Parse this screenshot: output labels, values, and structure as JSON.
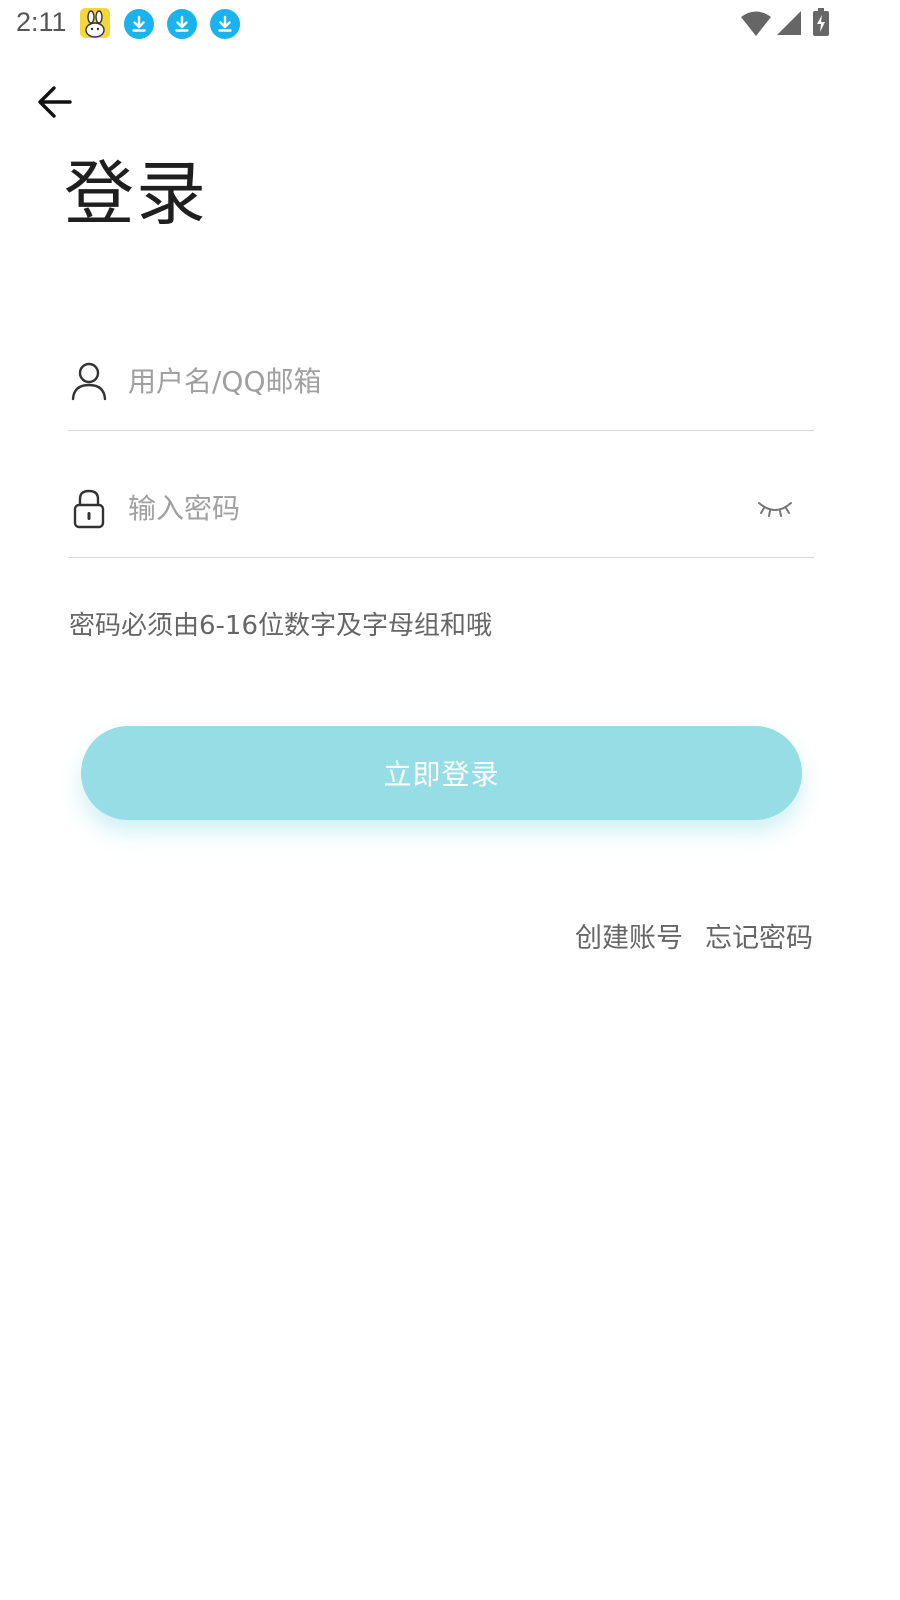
{
  "status_bar": {
    "time": "2:11",
    "icons": [
      "notification-app-icon",
      "download-icon",
      "download-icon",
      "download-icon",
      "wifi-icon",
      "signal-icon",
      "battery-charging-icon"
    ]
  },
  "header": {
    "back_icon": "arrow-left-icon",
    "title": "登录"
  },
  "form": {
    "username": {
      "icon": "person-icon",
      "placeholder": "用户名/QQ邮箱",
      "value": ""
    },
    "password": {
      "icon": "lock-icon",
      "placeholder": "输入密码",
      "value": "",
      "toggle_icon": "eye-closed-icon"
    },
    "hint": "密码必须由6-16位数字及字母组和哦"
  },
  "login_button": {
    "label": "立即登录",
    "color": "#97dde6"
  },
  "links": {
    "create_account": "创建账号",
    "forgot_password": "忘记密码"
  },
  "colors": {
    "accent": "#97dde6",
    "download_badge": "#19b3ef",
    "text_secondary": "#666666",
    "placeholder": "#a0a0a0"
  }
}
